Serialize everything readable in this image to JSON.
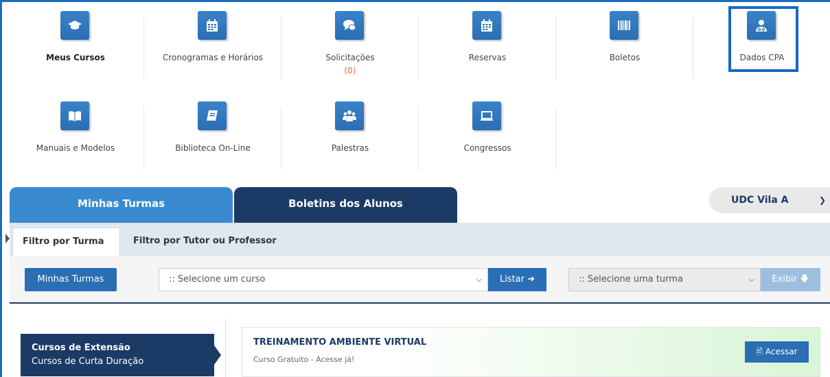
{
  "shortcuts_row1": [
    {
      "label": "Meus Cursos",
      "icon": "graduation-cap-icon",
      "bold": true
    },
    {
      "label": "Cronogramas e Horários",
      "icon": "calendar-icon"
    },
    {
      "label": "Solicitações",
      "icon": "chat-bubbles-icon",
      "count": "(0)"
    },
    {
      "label": "Reservas",
      "icon": "calendar-icon"
    },
    {
      "label": "Boletos",
      "icon": "barcode-icon"
    },
    {
      "label": "Dados CPA",
      "icon": "user-doctor-icon"
    }
  ],
  "shortcuts_row2": [
    {
      "label": "Manuais e Modelos",
      "icon": "open-book-icon"
    },
    {
      "label": "Biblioteca On-Line",
      "icon": "book-icon"
    },
    {
      "label": "Palestras",
      "icon": "users-icon"
    },
    {
      "label": "Congressos",
      "icon": "laptop-icon"
    }
  ],
  "tabs": {
    "minhas_turmas": "Minhas Turmas",
    "boletins": "Boletins dos Alunos"
  },
  "unit_selector": {
    "value": "UDC Vila A"
  },
  "subtabs": {
    "active": "Filtro por Turma",
    "other": "Filtro por Tutor ou Professor"
  },
  "filters": {
    "minhas_turmas_btn": "Minhas Turmas",
    "curso_select": ":: Selecione um curso",
    "listar_btn": "Listar",
    "turma_select": ":: Selecione uma turma",
    "exibir_btn": "Exibir"
  },
  "category": {
    "title": "Cursos de Extensão",
    "subtitle": "Cursos de Curta Duração"
  },
  "course": {
    "title": "TREINAMENTO AMBIENTE VIRTUAL",
    "subtitle": "Curso Gratuito - Acesse já!",
    "button": "Acessar"
  },
  "colors": {
    "primary": "#2a6eb3",
    "dark_navy": "#1c3a66",
    "highlight_border": "#1668c7",
    "count_orange": "#e8663d"
  }
}
